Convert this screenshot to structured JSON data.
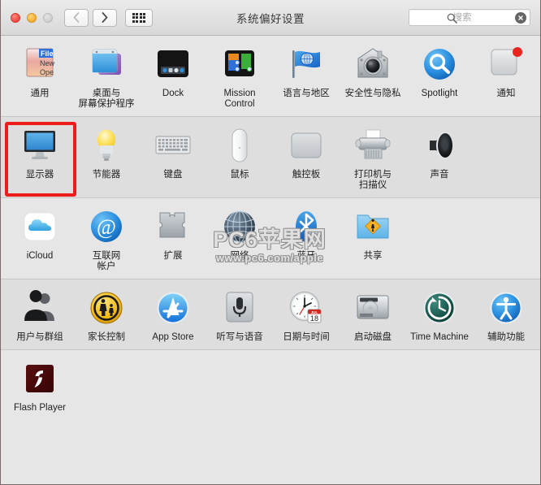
{
  "window": {
    "title": "系统偏好设置",
    "traffic_lights": [
      {
        "name": "close",
        "color": "#f1453d",
        "state": "enabled"
      },
      {
        "name": "minimize",
        "color": "#f6ae30",
        "state": "enabled"
      },
      {
        "name": "zoom",
        "color": "#cfcfcf",
        "state": "disabled"
      }
    ]
  },
  "toolbar": {
    "back_label": "后退",
    "forward_label": "前进",
    "showall_label": "显示全部",
    "back_enabled": false,
    "forward_enabled": true
  },
  "search": {
    "placeholder": "搜索",
    "value": "",
    "icon": "search-icon",
    "clear_icon": "clear-circle-icon"
  },
  "highlight": {
    "target": "显示器",
    "color": "#ee1b1b"
  },
  "watermark": {
    "line1": "PC6苹果网",
    "line2": "www.pc6.com/apple"
  },
  "groups": [
    {
      "id": "personal",
      "shaded": false,
      "items": [
        {
          "label": "通用",
          "icon": "general-icon"
        },
        {
          "label": "桌面与\n屏幕保护程序",
          "icon": "desktop-screensaver-icon"
        },
        {
          "label": "Dock",
          "icon": "dock-icon"
        },
        {
          "label": "Mission\nControl",
          "icon": "mission-control-icon"
        },
        {
          "label": "语言与地区",
          "icon": "language-region-icon"
        },
        {
          "label": "安全性与隐私",
          "icon": "security-privacy-icon"
        },
        {
          "label": "Spotlight",
          "icon": "spotlight-icon"
        },
        {
          "label": "通知",
          "icon": "notifications-icon"
        }
      ]
    },
    {
      "id": "hardware",
      "shaded": true,
      "items": [
        {
          "label": "显示器",
          "icon": "displays-icon"
        },
        {
          "label": "节能器",
          "icon": "energy-saver-icon"
        },
        {
          "label": "键盘",
          "icon": "keyboard-icon"
        },
        {
          "label": "鼠标",
          "icon": "mouse-icon"
        },
        {
          "label": "触控板",
          "icon": "trackpad-icon"
        },
        {
          "label": "打印机与\n扫描仪",
          "icon": "printers-scanners-icon"
        },
        {
          "label": "声音",
          "icon": "sound-icon"
        }
      ]
    },
    {
      "id": "internet",
      "shaded": false,
      "items": [
        {
          "label": "iCloud",
          "icon": "icloud-icon"
        },
        {
          "label": "互联网\n帐户",
          "icon": "internet-accounts-icon"
        },
        {
          "label": "扩展",
          "icon": "extensions-icon"
        },
        {
          "label": "网络",
          "icon": "network-icon"
        },
        {
          "label": "蓝牙",
          "icon": "bluetooth-icon"
        },
        {
          "label": "共享",
          "icon": "sharing-icon"
        }
      ]
    },
    {
      "id": "system",
      "shaded": true,
      "items": [
        {
          "label": "用户与群组",
          "icon": "users-groups-icon"
        },
        {
          "label": "家长控制",
          "icon": "parental-controls-icon"
        },
        {
          "label": "App Store",
          "icon": "app-store-icon"
        },
        {
          "label": "听写与语音",
          "icon": "dictation-speech-icon"
        },
        {
          "label": "日期与时间",
          "icon": "date-time-icon"
        },
        {
          "label": "启动磁盘",
          "icon": "startup-disk-icon"
        },
        {
          "label": "Time Machine",
          "icon": "time-machine-icon"
        },
        {
          "label": "辅助功能",
          "icon": "accessibility-icon"
        }
      ]
    },
    {
      "id": "other",
      "shaded": false,
      "items": [
        {
          "label": "Flash Player",
          "icon": "flash-player-icon"
        }
      ]
    }
  ]
}
